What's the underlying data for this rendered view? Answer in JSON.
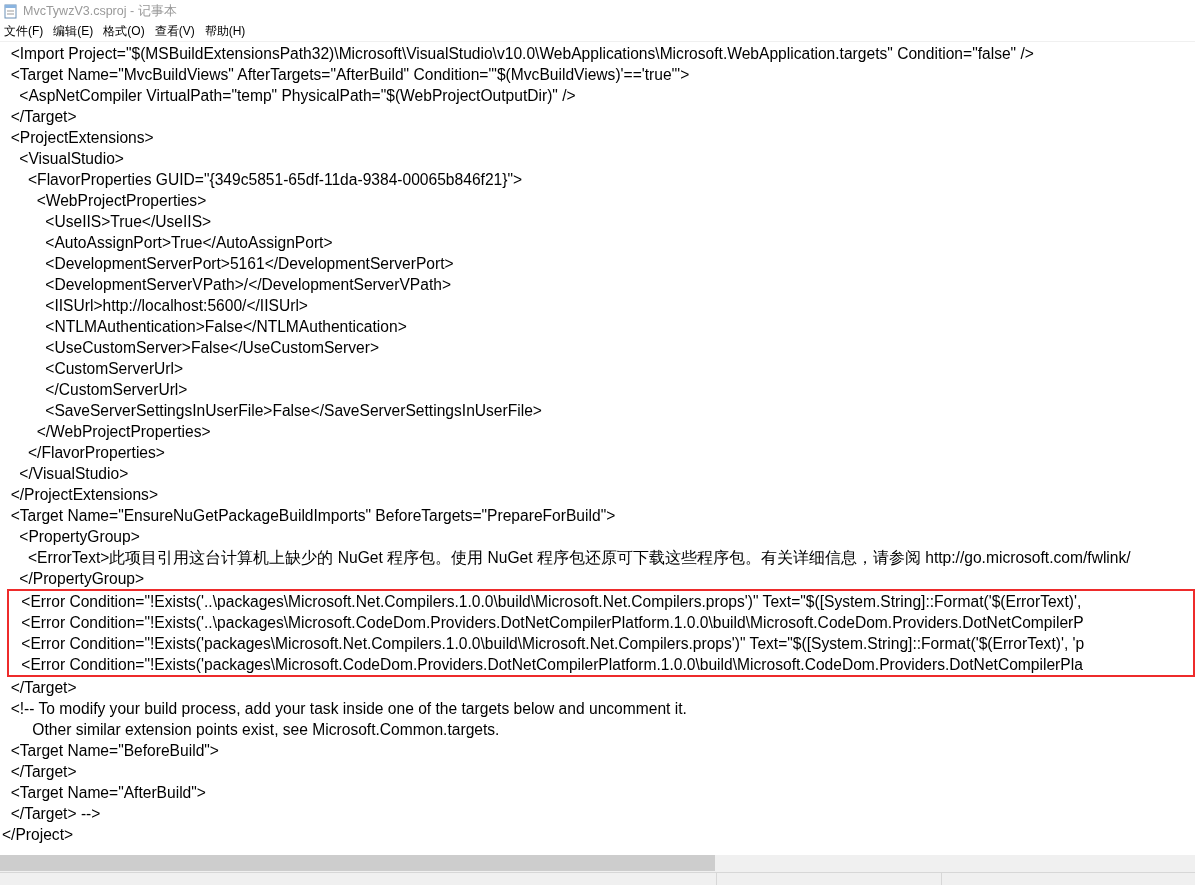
{
  "window": {
    "title": "MvcTywzV3.csproj - 记事本"
  },
  "menu": [
    "文件(F)",
    "编辑(E)",
    "格式(O)",
    "查看(V)",
    "帮助(H)"
  ],
  "lines": [
    {
      "text": "  <Import Project=\"$(MSBuildExtensionsPath32)\\Microsoft\\VisualStudio\\v10.0\\WebApplications\\Microsoft.WebApplication.targets\" Condition=\"false\" />",
      "highlighted": false
    },
    {
      "text": "  <Target Name=\"MvcBuildViews\" AfterTargets=\"AfterBuild\" Condition=\"'$(MvcBuildViews)'=='true'\">",
      "highlighted": false
    },
    {
      "text": "    <AspNetCompiler VirtualPath=\"temp\" PhysicalPath=\"$(WebProjectOutputDir)\" />",
      "highlighted": false
    },
    {
      "text": "  </Target>",
      "highlighted": false
    },
    {
      "text": "  <ProjectExtensions>",
      "highlighted": false
    },
    {
      "text": "    <VisualStudio>",
      "highlighted": false
    },
    {
      "text": "      <FlavorProperties GUID=\"{349c5851-65df-11da-9384-00065b846f21}\">",
      "highlighted": false
    },
    {
      "text": "        <WebProjectProperties>",
      "highlighted": false
    },
    {
      "text": "          <UseIIS>True</UseIIS>",
      "highlighted": false
    },
    {
      "text": "          <AutoAssignPort>True</AutoAssignPort>",
      "highlighted": false
    },
    {
      "text": "          <DevelopmentServerPort>5161</DevelopmentServerPort>",
      "highlighted": false
    },
    {
      "text": "          <DevelopmentServerVPath>/</DevelopmentServerVPath>",
      "highlighted": false
    },
    {
      "text": "          <IISUrl>http://localhost:5600/</IISUrl>",
      "highlighted": false
    },
    {
      "text": "          <NTLMAuthentication>False</NTLMAuthentication>",
      "highlighted": false
    },
    {
      "text": "          <UseCustomServer>False</UseCustomServer>",
      "highlighted": false
    },
    {
      "text": "          <CustomServerUrl>",
      "highlighted": false
    },
    {
      "text": "          </CustomServerUrl>",
      "highlighted": false
    },
    {
      "text": "          <SaveServerSettingsInUserFile>False</SaveServerSettingsInUserFile>",
      "highlighted": false
    },
    {
      "text": "        </WebProjectProperties>",
      "highlighted": false
    },
    {
      "text": "      </FlavorProperties>",
      "highlighted": false
    },
    {
      "text": "    </VisualStudio>",
      "highlighted": false
    },
    {
      "text": "  </ProjectExtensions>",
      "highlighted": false
    },
    {
      "text": "  <Target Name=\"EnsureNuGetPackageBuildImports\" BeforeTargets=\"PrepareForBuild\">",
      "highlighted": false
    },
    {
      "text": "    <PropertyGroup>",
      "highlighted": false
    },
    {
      "text": "      <ErrorText>此项目引用这台计算机上缺少的 NuGet 程序包。使用 NuGet 程序包还原可下载这些程序包。有关详细信息，请参阅 http://go.microsoft.com/fwlink/",
      "highlighted": false
    },
    {
      "text": "    </PropertyGroup>",
      "highlighted": false
    },
    {
      "text": "    <Error Condition=\"!Exists('..\\packages\\Microsoft.Net.Compilers.1.0.0\\build\\Microsoft.Net.Compilers.props')\" Text=\"$([System.String]::Format('$(ErrorText)',",
      "highlighted": true
    },
    {
      "text": "    <Error Condition=\"!Exists('..\\packages\\Microsoft.CodeDom.Providers.DotNetCompilerPlatform.1.0.0\\build\\Microsoft.CodeDom.Providers.DotNetCompilerP",
      "highlighted": true
    },
    {
      "text": "    <Error Condition=\"!Exists('packages\\Microsoft.Net.Compilers.1.0.0\\build\\Microsoft.Net.Compilers.props')\" Text=\"$([System.String]::Format('$(ErrorText)', 'p",
      "highlighted": true
    },
    {
      "text": "    <Error Condition=\"!Exists('packages\\Microsoft.CodeDom.Providers.DotNetCompilerPlatform.1.0.0\\build\\Microsoft.CodeDom.Providers.DotNetCompilerPla",
      "highlighted": true
    },
    {
      "text": "  </Target>",
      "highlighted": false
    },
    {
      "text": "  <!-- To modify your build process, add your task inside one of the targets below and uncomment it.",
      "highlighted": false
    },
    {
      "text": "       Other similar extension points exist, see Microsoft.Common.targets.",
      "highlighted": false
    },
    {
      "text": "  <Target Name=\"BeforeBuild\">",
      "highlighted": false
    },
    {
      "text": "  </Target>",
      "highlighted": false
    },
    {
      "text": "  <Target Name=\"AfterBuild\">",
      "highlighted": false
    },
    {
      "text": "  </Target> -->",
      "highlighted": false
    },
    {
      "text": "</Project>",
      "highlighted": false
    }
  ]
}
